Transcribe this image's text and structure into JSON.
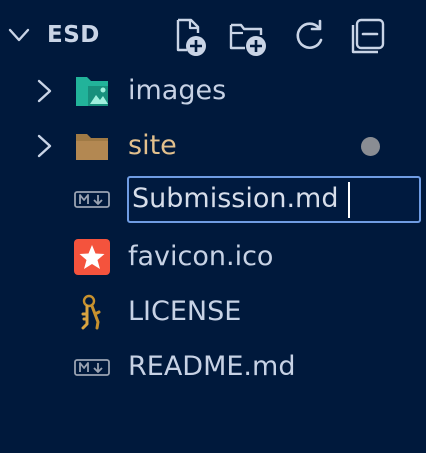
{
  "explorer": {
    "section_title": "ESD",
    "actions": [
      {
        "name": "new-file-icon"
      },
      {
        "name": "new-folder-icon"
      },
      {
        "name": "refresh-icon"
      },
      {
        "name": "collapse-all-icon"
      }
    ],
    "items": [
      {
        "label": "images",
        "type": "folder",
        "icon": "images-folder-icon",
        "expanded": false
      },
      {
        "label": "site",
        "type": "folder",
        "icon": "folder-icon",
        "expanded": false,
        "modified": true
      },
      {
        "label": "Submission.md",
        "type": "file",
        "icon": "markdown-icon",
        "editing": true
      },
      {
        "label": "favicon.ico",
        "type": "file",
        "icon": "favicon-star-icon"
      },
      {
        "label": "LICENSE",
        "type": "file",
        "icon": "license-key-icon"
      },
      {
        "label": "README.md",
        "type": "file",
        "icon": "markdown-icon"
      }
    ]
  },
  "colors": {
    "background": "#00193c",
    "text": "#c7d2e5",
    "modified_text": "#e2c08d",
    "input_border": "#6f9ce3",
    "images_folder": "#22b39a",
    "folder": "#a07a45",
    "favicon": "#f4533d"
  }
}
